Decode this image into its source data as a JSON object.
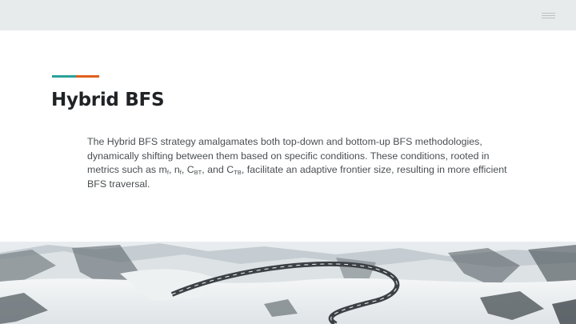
{
  "slide": {
    "title": "Hybrid BFS",
    "paragraph": {
      "intro": "The Hybrid BFS strategy amalgamates both top-down and bottom-up BFS methodologies, dynamically shifting between them based on specific conditions. These conditions, rooted in metrics such as ",
      "m": "m",
      "m_sub": "f",
      "sep1": ", ",
      "n": "n",
      "n_sub": "f",
      "sep2": ", ",
      "c1": "C",
      "c1_sub": "BT",
      "sep3": ", and ",
      "c2": "C",
      "c2_sub": "TB",
      "outro": ", facilitate an adaptive frontier size, resulting in more efficient BFS traversal."
    }
  },
  "icons": {
    "menu": "hamburger-menu-icon"
  },
  "colors": {
    "topbar": "#e8ebec",
    "accent_teal": "#2aa198",
    "accent_orange": "#e0601c",
    "title": "#1f2326",
    "body": "#4a4f52"
  }
}
